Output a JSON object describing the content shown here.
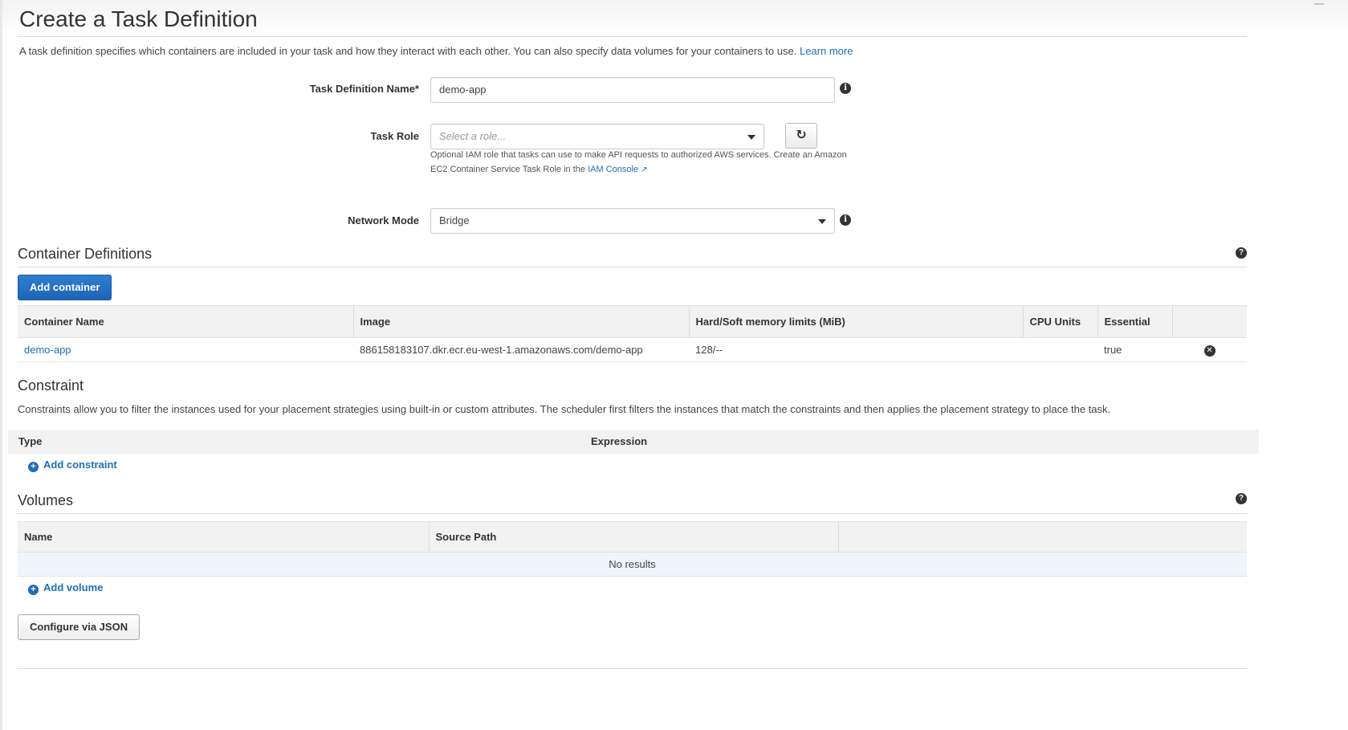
{
  "page": {
    "title": "Create a Task Definition",
    "intro_text": "A task definition specifies which containers are included in your task and how they interact with each other. You can also specify data volumes for your containers to use.",
    "learn_more": "Learn more"
  },
  "form": {
    "task_definition_name": {
      "label": "Task Definition Name*",
      "value": "demo-app"
    },
    "task_role": {
      "label": "Task Role",
      "placeholder": "Select a role...",
      "hint_prefix": "Optional IAM role that tasks can use to make API requests to authorized AWS services. Create an Amazon EC2 Container Service Task Role in the",
      "hint_link": "IAM Console"
    },
    "network_mode": {
      "label": "Network Mode",
      "value": "Bridge"
    }
  },
  "container_definitions": {
    "title": "Container Definitions",
    "add_button": "Add container",
    "columns": [
      "Container Name",
      "Image",
      "Hard/Soft memory limits (MiB)",
      "CPU Units",
      "Essential"
    ],
    "rows": [
      {
        "name": "demo-app",
        "image": "886158183107.dkr.ecr.eu-west-1.amazonaws.com/demo-app",
        "memory": "128/--",
        "cpu": "",
        "essential": "true"
      }
    ]
  },
  "constraint": {
    "title": "Constraint",
    "description": "Constraints allow you to filter the instances used for your placement strategies using built-in or custom attributes. The scheduler first filters the instances that match the constraints and then applies the placement strategy to place the task.",
    "columns": [
      "Type",
      "Expression"
    ],
    "add_link": "Add constraint"
  },
  "volumes": {
    "title": "Volumes",
    "columns": [
      "Name",
      "Source Path"
    ],
    "empty_text": "No results",
    "add_link": "Add volume"
  },
  "configure_json_button": "Configure via JSON",
  "icons": {
    "info": "info-icon",
    "help": "question-circle-icon",
    "refresh": "refresh-icon",
    "external": "external-link-icon",
    "remove": "remove-circle-icon",
    "add": "plus-circle-icon"
  },
  "colors": {
    "link": "#1f6fb5",
    "primary": "#1d64b5",
    "table_header": "#f2f2f2",
    "empty_row": "#eef5fb"
  }
}
